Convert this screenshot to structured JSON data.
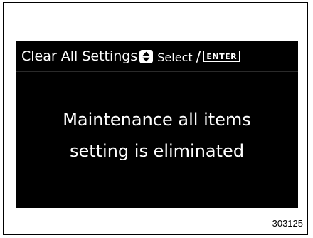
{
  "screen": {
    "header": {
      "title": "Clear All Settings",
      "updown_icon": "up-down-arrows-icon",
      "select_label": "Select",
      "separator": "/",
      "enter_label": "ENTER"
    },
    "message": {
      "line1": "Maintenance all items",
      "line2": "setting is eliminated"
    }
  },
  "figure_number": "303125",
  "colors": {
    "screen_background": "#000000",
    "text": "#ffffff",
    "page_background": "#ffffff"
  }
}
